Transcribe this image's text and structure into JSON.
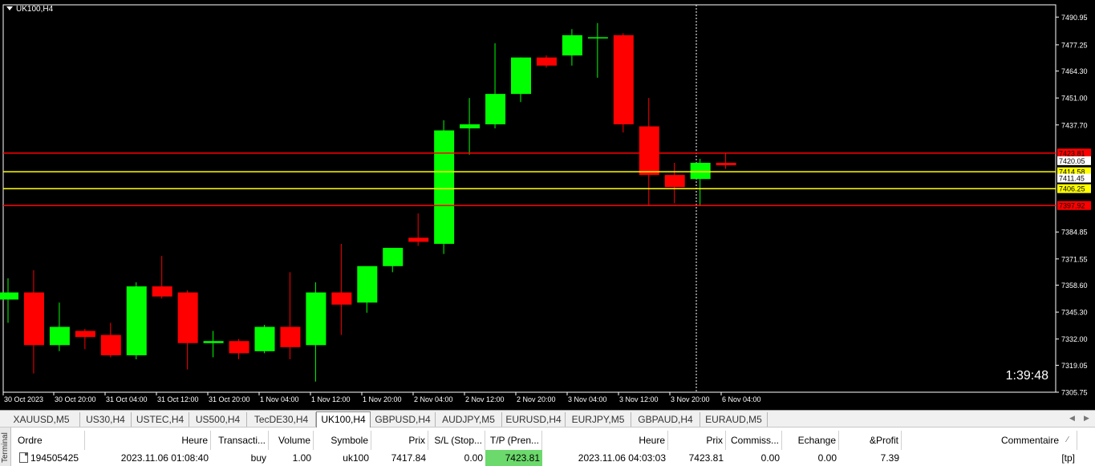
{
  "chart": {
    "symbol_label": "UK100,H4",
    "countdown": "1:39:48",
    "colors": {
      "bull": "#00ff00",
      "bear": "#ff0000",
      "background": "#000000",
      "grid_text": "#ffffff",
      "red_line": "#ff0000",
      "yellow_line": "#ffff00"
    }
  },
  "chart_data": {
    "type": "candlestick",
    "symbol": "UK100",
    "timeframe": "H4",
    "ylim": [
      7305.75,
      7497.0
    ],
    "y_ticks": [
      "7490.95",
      "7477.25",
      "7464.30",
      "7451.00",
      "7437.70",
      "7384.85",
      "7371.55",
      "7358.60",
      "7345.30",
      "7332.00",
      "7319.05",
      "7305.75"
    ],
    "y_tick_values": [
      7490.95,
      7477.25,
      7464.3,
      7451.0,
      7437.7,
      7384.85,
      7371.55,
      7358.6,
      7345.3,
      7332.0,
      7319.05,
      7305.75
    ],
    "x_labels": [
      "30 Oct 2023",
      "30 Oct 20:00",
      "31 Oct 04:00",
      "31 Oct 12:00",
      "31 Oct 20:00",
      "1 Nov 04:00",
      "1 Nov 12:00",
      "1 Nov 20:00",
      "2 Nov 04:00",
      "2 Nov 12:00",
      "2 Nov 20:00",
      "3 Nov 04:00",
      "3 Nov 12:00",
      "3 Nov 20:00",
      "6 Nov 04:00"
    ],
    "candles": [
      {
        "o": 7351.5,
        "h": 7362.0,
        "l": 7340.0,
        "c": 7355.0
      },
      {
        "o": 7355.0,
        "h": 7366.0,
        "l": 7315.0,
        "c": 7329.0
      },
      {
        "o": 7329.0,
        "h": 7350.0,
        "l": 7326.0,
        "c": 7338.0
      },
      {
        "o": 7336.0,
        "h": 7337.0,
        "l": 7327.0,
        "c": 7333.0
      },
      {
        "o": 7334.0,
        "h": 7340.0,
        "l": 7323.0,
        "c": 7324.0
      },
      {
        "o": 7324.0,
        "h": 7360.0,
        "l": 7322.0,
        "c": 7358.0
      },
      {
        "o": 7358.0,
        "h": 7373.0,
        "l": 7352.0,
        "c": 7353.0
      },
      {
        "o": 7355.0,
        "h": 7356.0,
        "l": 7317.0,
        "c": 7330.0
      },
      {
        "o": 7330.0,
        "h": 7336.0,
        "l": 7323.0,
        "c": 7331.0
      },
      {
        "o": 7331.0,
        "h": 7332.0,
        "l": 7322.0,
        "c": 7325.0
      },
      {
        "o": 7326.0,
        "h": 7339.0,
        "l": 7325.0,
        "c": 7338.0
      },
      {
        "o": 7338.0,
        "h": 7365.0,
        "l": 7322.0,
        "c": 7328.0
      },
      {
        "o": 7329.0,
        "h": 7360.0,
        "l": 7311.0,
        "c": 7355.0
      },
      {
        "o": 7355.0,
        "h": 7379.0,
        "l": 7334.0,
        "c": 7349.0
      },
      {
        "o": 7350.0,
        "h": 7367.0,
        "l": 7345.0,
        "c": 7368.0
      },
      {
        "o": 7368.0,
        "h": 7376.0,
        "l": 7365.0,
        "c": 7377.0
      },
      {
        "o": 7382.0,
        "h": 7394.0,
        "l": 7378.0,
        "c": 7380.0
      },
      {
        "o": 7379.0,
        "h": 7440.0,
        "l": 7374.0,
        "c": 7435.0
      },
      {
        "o": 7436.0,
        "h": 7451.0,
        "l": 7423.0,
        "c": 7438.0
      },
      {
        "o": 7438.0,
        "h": 7478.0,
        "l": 7436.0,
        "c": 7453.0
      },
      {
        "o": 7453.0,
        "h": 7471.0,
        "l": 7449.0,
        "c": 7471.0
      },
      {
        "o": 7471.0,
        "h": 7472.0,
        "l": 7466.0,
        "c": 7467.0
      },
      {
        "o": 7472.0,
        "h": 7485.0,
        "l": 7467.0,
        "c": 7482.0
      },
      {
        "o": 7481.0,
        "h": 7488.0,
        "l": 7461.0,
        "c": 7481.0
      },
      {
        "o": 7482.0,
        "h": 7483.0,
        "l": 7434.0,
        "c": 7438.0
      },
      {
        "o": 7437.0,
        "h": 7451.0,
        "l": 7398.0,
        "c": 7413.0
      },
      {
        "o": 7413.0,
        "h": 7419.0,
        "l": 7399.0,
        "c": 7407.0
      },
      {
        "o": 7411.0,
        "h": 7421.0,
        "l": 7398.0,
        "c": 7419.0
      },
      {
        "o": 7419.0,
        "h": 7424.0,
        "l": 7416.0,
        "c": 7417.8
      }
    ],
    "horizontal_lines": [
      {
        "value": 7423.81,
        "color": "#ff0000",
        "label": "7423.81"
      },
      {
        "value": 7414.58,
        "color": "#ffff00",
        "label": "7414.58"
      },
      {
        "value": 7406.25,
        "color": "#ffff00",
        "label": "7406.25"
      },
      {
        "value": 7397.92,
        "color": "#ff0000",
        "label": "7397.92"
      }
    ],
    "price_tags": [
      {
        "value": 7420.05,
        "label": "7420.05"
      },
      {
        "value": 7411.45,
        "label": "7411.45"
      }
    ]
  },
  "tabs": [
    "XAUUSD,M5",
    "US30,H4",
    "USTEC,H4",
    "US500,H4",
    "TecDE30,H4",
    "UK100,H4",
    "GBPUSD,H4",
    "AUDJPY,M5",
    "EURUSD,H4",
    "EURJPY,M5",
    "GBPAUD,H4",
    "EURAUD,M5"
  ],
  "active_tab": "UK100,H4",
  "terminal": {
    "side_label": "Terminal",
    "headers": [
      "Ordre",
      "Heure",
      "Transacti...",
      "Volume",
      "Symbole",
      "Prix",
      "S/L (Stop...",
      "T/P (Pren...",
      "Heure",
      "Prix",
      "Commiss...",
      "Echange",
      "&Profit",
      "Commentaire"
    ],
    "row": [
      "194505425",
      "2023.11.06 01:08:40",
      "buy",
      "1.00",
      "uk100",
      "7417.84",
      "0.00",
      "7423.81",
      "2023.11.06 04:03:03",
      "7423.81",
      "0.00",
      "0.00",
      "7.39",
      "[tp]"
    ]
  }
}
